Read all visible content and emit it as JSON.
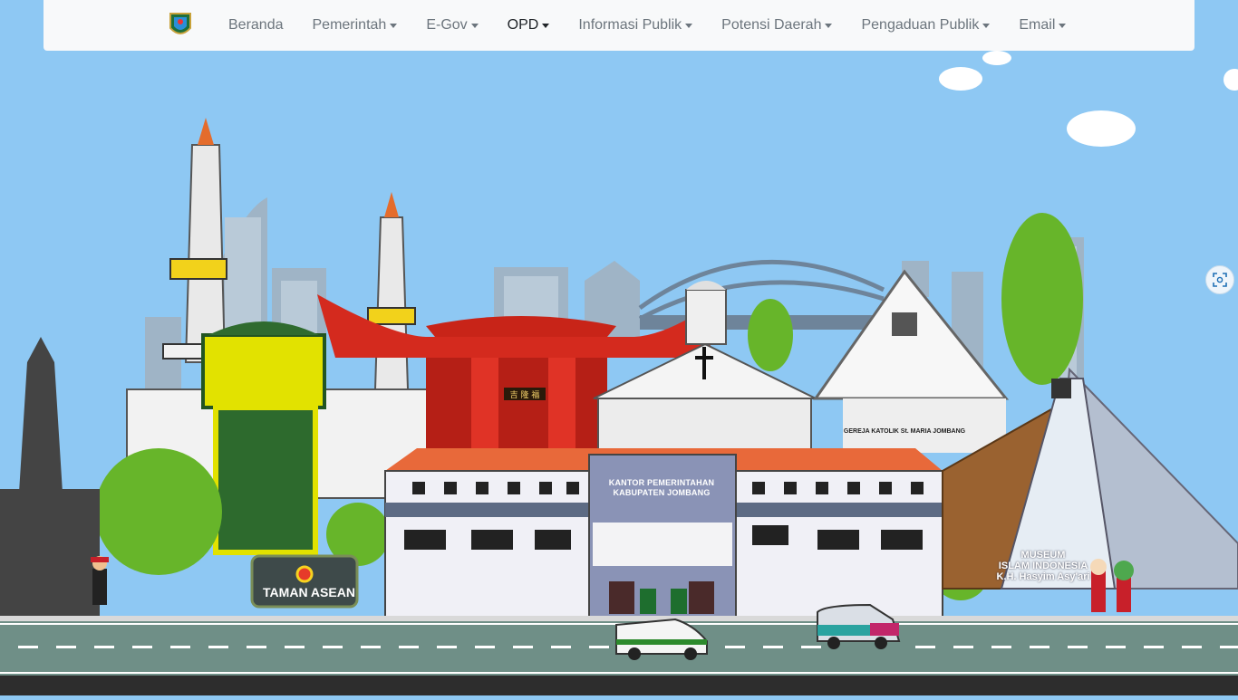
{
  "nav": {
    "items": [
      {
        "label": "Beranda",
        "dropdown": false,
        "active": false
      },
      {
        "label": "Pemerintah",
        "dropdown": true,
        "active": false
      },
      {
        "label": "E-Gov",
        "dropdown": true,
        "active": false
      },
      {
        "label": "OPD",
        "dropdown": true,
        "active": true
      },
      {
        "label": "Informasi Publik",
        "dropdown": true,
        "active": false
      },
      {
        "label": "Potensi Daerah",
        "dropdown": true,
        "active": false
      },
      {
        "label": "Pengaduan Publik",
        "dropdown": true,
        "active": false
      },
      {
        "label": "Email",
        "dropdown": true,
        "active": false
      }
    ],
    "logo_icon": "jombang-regency-crest-icon"
  },
  "banner": {
    "sign_label": "TAMAN ASEAN",
    "building_label_line1": "KANTOR PEMERINTAHAN",
    "building_label_line2": "KABUPATEN JOMBANG",
    "church_label": "GEREJA KATOLIK St. MARIA JOMBANG",
    "museum_line1": "MUSEUM",
    "museum_line2": "ISLAM INDONESIA",
    "museum_line3": "K.H. Hasyim Asy'ari",
    "temple_sign": "吉 隆 福"
  },
  "floating": {
    "scan_icon": "image-scan-icon"
  },
  "colors": {
    "sky": "#8ec8f3",
    "nav_bg": "#f8f9fa",
    "nav_text": "#6c757d",
    "nav_active": "#212529",
    "road": "#6f8f87",
    "roof": "#e8693a",
    "temple_red": "#d42a1e"
  }
}
